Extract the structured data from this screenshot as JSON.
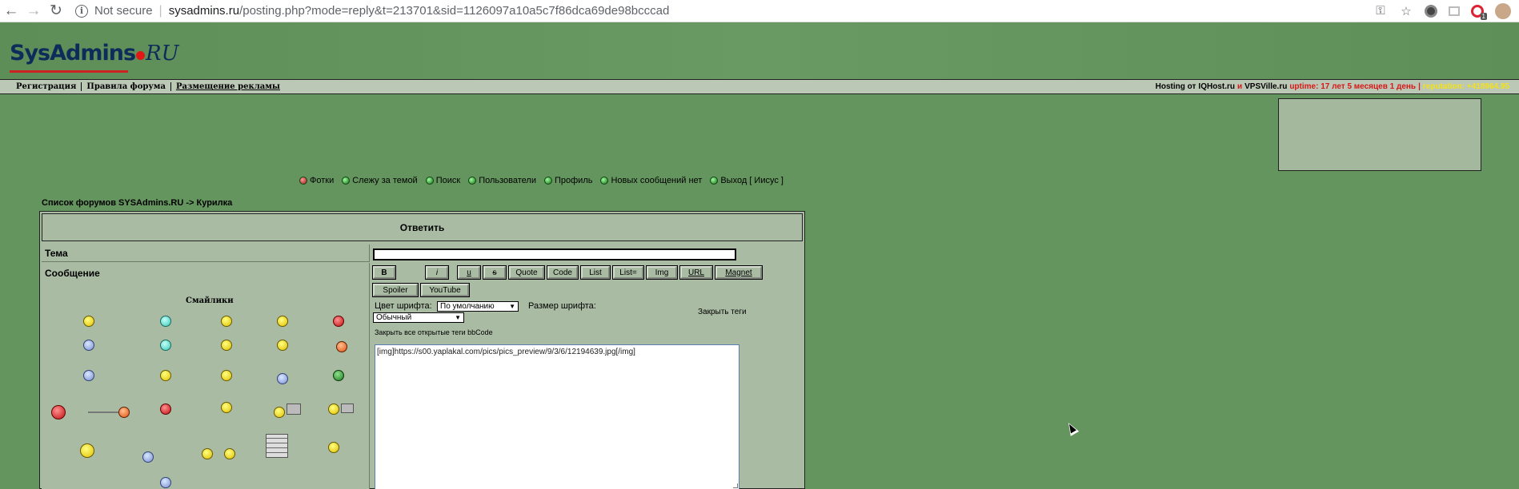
{
  "browser": {
    "not_secure": "Not secure",
    "url_host": "sysadmins.ru",
    "url_rest": "/posting.php?mode=reply&t=213701&sid=1126097a10a5c7f86dca69de98bcccad",
    "extension_badge": "1"
  },
  "site": {
    "logo_main": "SysAdmins",
    "logo_tld": "RU"
  },
  "info_bar": {
    "links": [
      "Регистрация",
      "Правила форума",
      "Размещение рекламы"
    ],
    "hosting_prefix": "Hosting от",
    "hosting_a": "IQHost.ru",
    "hosting_and": "и",
    "hosting_b": "VPSVille.ru",
    "uptime": "uptime: 17 лет 5 месяцев 1 день",
    "reputation": "reputation: +418964.95"
  },
  "nav": {
    "items": [
      {
        "label": "Фотки",
        "icon": "red-dot-icon"
      },
      {
        "label": "Слежу за темой",
        "icon": "green-dot-icon"
      },
      {
        "label": "Поиск",
        "icon": "green-dot-icon"
      },
      {
        "label": "Пользователи",
        "icon": "green-dot-icon"
      },
      {
        "label": "Профиль",
        "icon": "green-dot-icon"
      },
      {
        "label": "Новых сообщений нет",
        "icon": "green-dot-icon"
      },
      {
        "label": "Выход [ Иисус ]",
        "icon": "green-dot-icon"
      }
    ]
  },
  "breadcrumb": "Список форумов SYSAdmins.RU -> Курилка",
  "form": {
    "title": "Ответить",
    "subject_label": "Тема",
    "subject_value": "",
    "message_label": "Сообщение",
    "smiles_label": "Смайлики",
    "buttons": {
      "b": "B",
      "i": "i",
      "u": "u",
      "s": "s",
      "quote": "Quote",
      "code": "Code",
      "list": "List",
      "list_eq": "List=",
      "img": "Img",
      "url": "URL",
      "magnet": "Magnet",
      "spoiler": "Spoiler",
      "youtube": "YouTube"
    },
    "font_color_label": "Цвет шрифта:",
    "font_color_value": "По умолчанию",
    "font_size_label": "Размер шрифта:",
    "font_size_value": "Обычный",
    "close_tags": "Закрыть теги",
    "close_all_tags": "Закрыть все открытые теги bbCode",
    "message_value": "[img]https://s00.yaplakal.com/pics/pics_preview/9/3/6/12194639.jpg[/img]"
  }
}
